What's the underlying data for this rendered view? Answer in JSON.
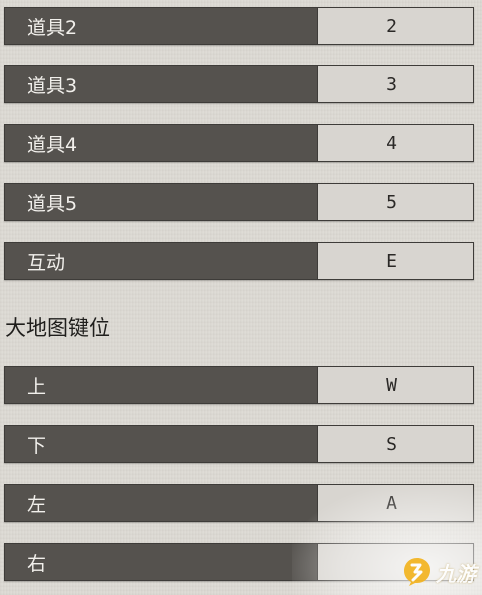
{
  "item_rows": [
    {
      "label": "道具2",
      "key": "2"
    },
    {
      "label": "道具3",
      "key": "3"
    },
    {
      "label": "道具4",
      "key": "4"
    },
    {
      "label": "道具5",
      "key": "5"
    },
    {
      "label": "互动",
      "key": "E"
    }
  ],
  "map_section": {
    "title": "大地图键位",
    "rows": [
      {
        "label": "上",
        "key": "W"
      },
      {
        "label": "下",
        "key": "S"
      },
      {
        "label": "左",
        "key": "A"
      },
      {
        "label": "右",
        "key": ""
      }
    ]
  },
  "watermark": {
    "text": "九游",
    "icon": "jiuyou-logo-icon"
  }
}
